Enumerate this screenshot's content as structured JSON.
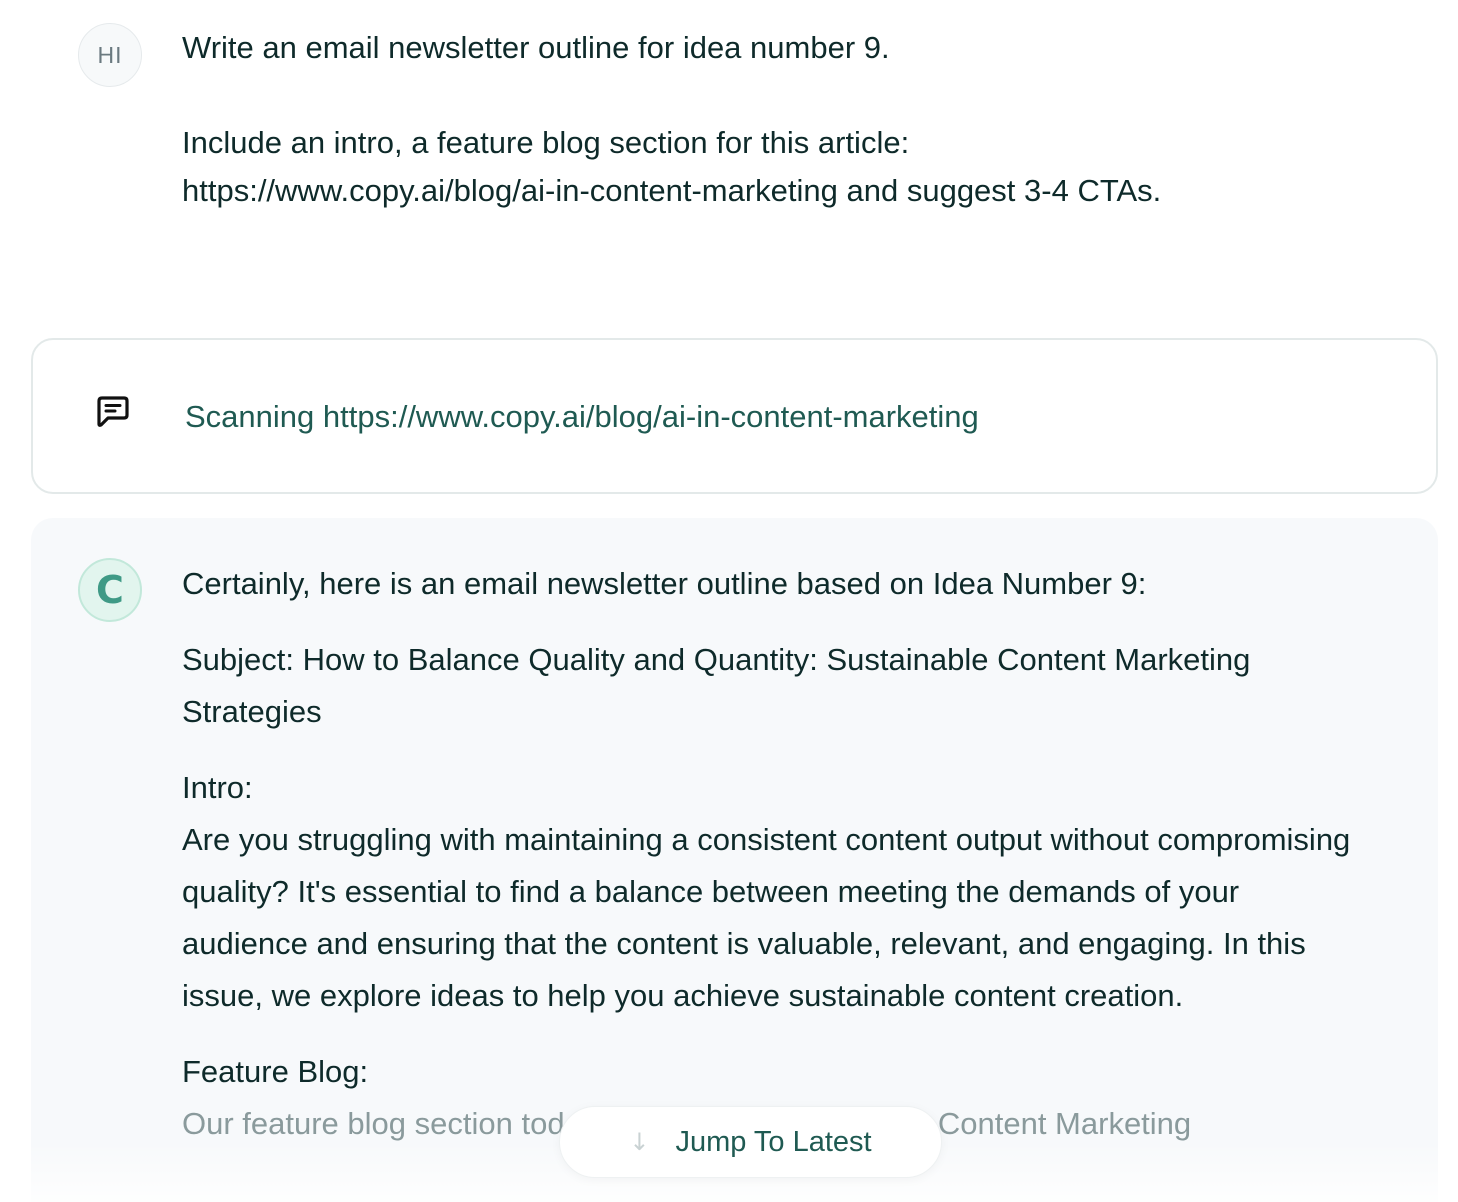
{
  "user_message": {
    "avatar_initials": "HI",
    "paragraphs": [
      "Write an email newsletter outline for idea number 9.",
      "Include an intro, a feature blog section for this article:\nhttps://www.copy.ai/blog/ai-in-content-marketing and suggest 3-4 CTAs."
    ]
  },
  "scan_card": {
    "icon": "chat-bubble-icon",
    "text": "Scanning https://www.copy.ai/blog/ai-in-content-marketing"
  },
  "assistant_message": {
    "avatar_letter": "C",
    "intro_line": "Certainly, here is an email newsletter outline based on Idea Number 9:",
    "subject": "Subject: How to Balance Quality and Quantity: Sustainable Content Marketing Strategies",
    "intro_heading": "Intro:",
    "intro_body": "Are you struggling with maintaining a consistent content output without compromising quality? It's essential to find a balance between meeting the demands of your audience and ensuring that the content is valuable, relevant, and engaging. In this issue, we explore ideas to help you achieve sustainable content creation.",
    "feature_heading": "Feature Blog:",
    "feature_body": "Our feature blog section today is 11 Ways To Use AI In Content Marketing"
  },
  "jump_button": {
    "label": "Jump To Latest",
    "icon": "arrow-down-icon"
  },
  "colors": {
    "text": "#0e2a2a",
    "accent": "#1f5a52",
    "assistant_bg": "#f7f9fb",
    "avatar_green": "#3f9a86"
  }
}
